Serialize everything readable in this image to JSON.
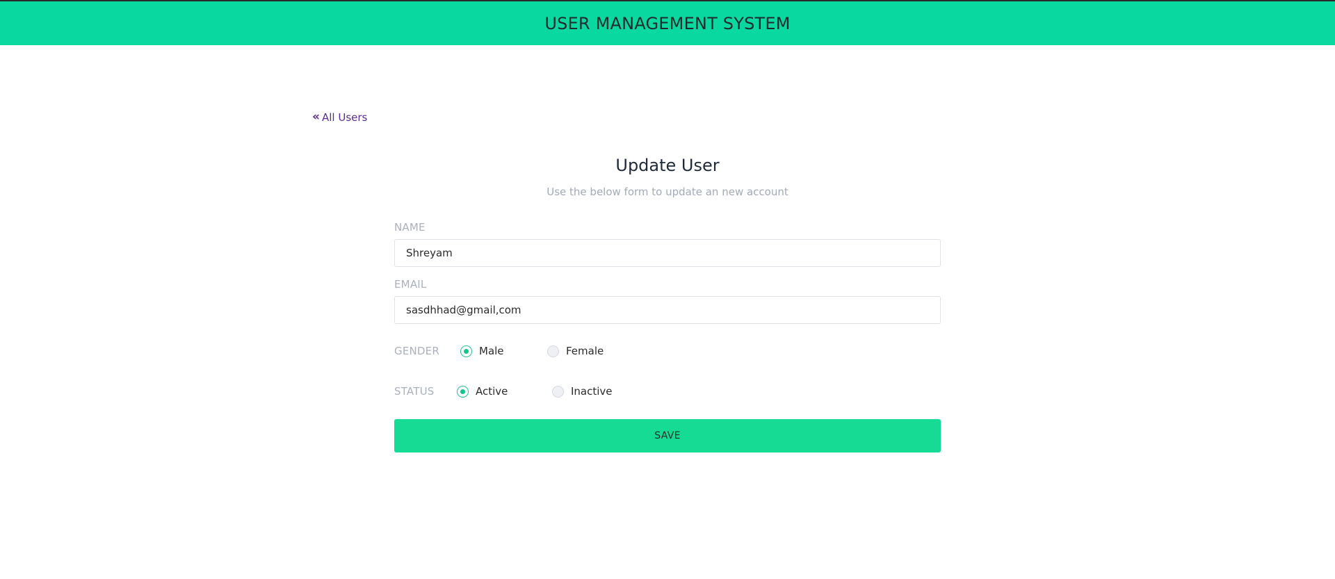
{
  "header": {
    "title": "USER MANAGEMENT SYSTEM",
    "color": "#09d9a1"
  },
  "nav": {
    "back_label": "All Users",
    "back_icon": "double-chevron-left-icon",
    "back_glyph": "«"
  },
  "form": {
    "title": "Update User",
    "subtitle": "Use the below form to update an new account",
    "name": {
      "label": "NAME",
      "value": "Shreyam"
    },
    "email": {
      "label": "EMAIL",
      "value": "sasdhhad@gmail,com"
    },
    "gender": {
      "label": "GENDER",
      "options": [
        "Male",
        "Female"
      ],
      "selected": "Male"
    },
    "status": {
      "label": "STATUS",
      "options": [
        "Active",
        "Inactive"
      ],
      "selected": "Active"
    },
    "save_label": "SAVE"
  },
  "colors": {
    "accent": "#16db94",
    "link": "#5b2c8f",
    "radio_checked": "#16c58e"
  }
}
